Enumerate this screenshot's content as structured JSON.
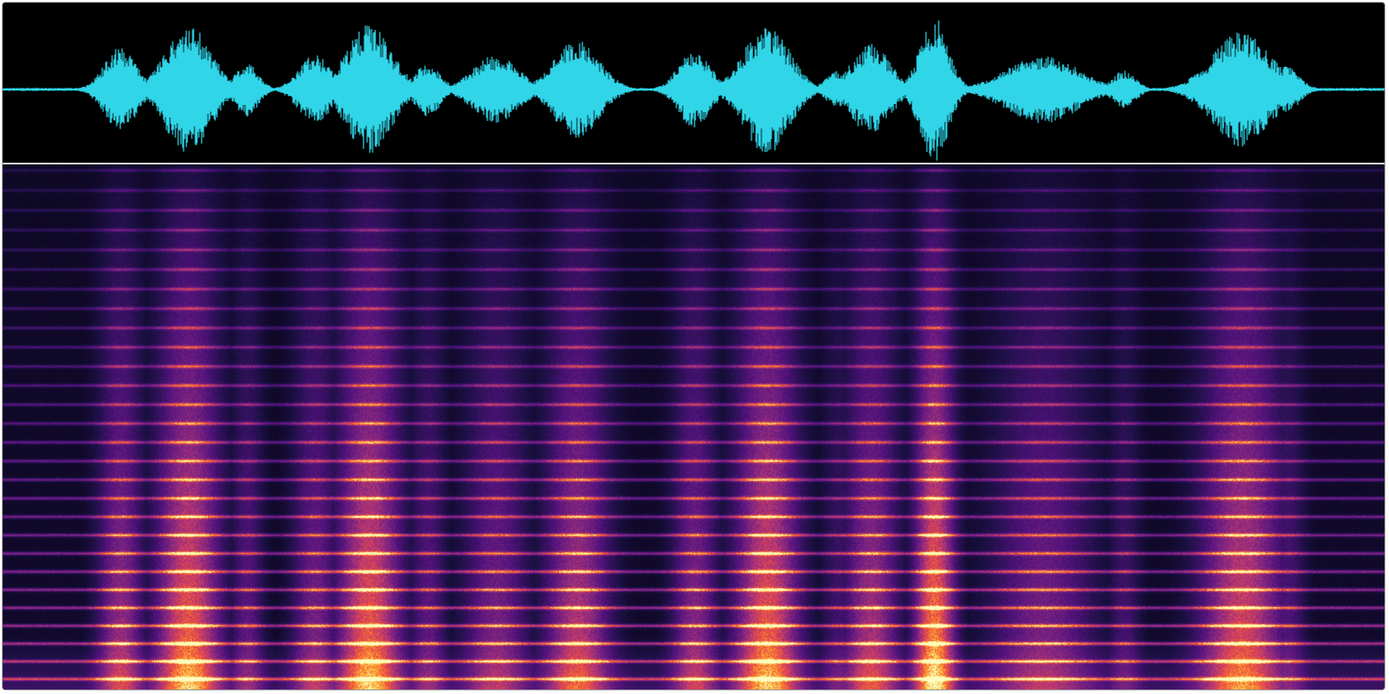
{
  "waveform": {
    "color": "#30d5e8",
    "background": "#000000"
  },
  "spectrogram": {
    "colormap": "magma",
    "background": "#000000"
  },
  "divider_color": "#cfcfcf"
}
